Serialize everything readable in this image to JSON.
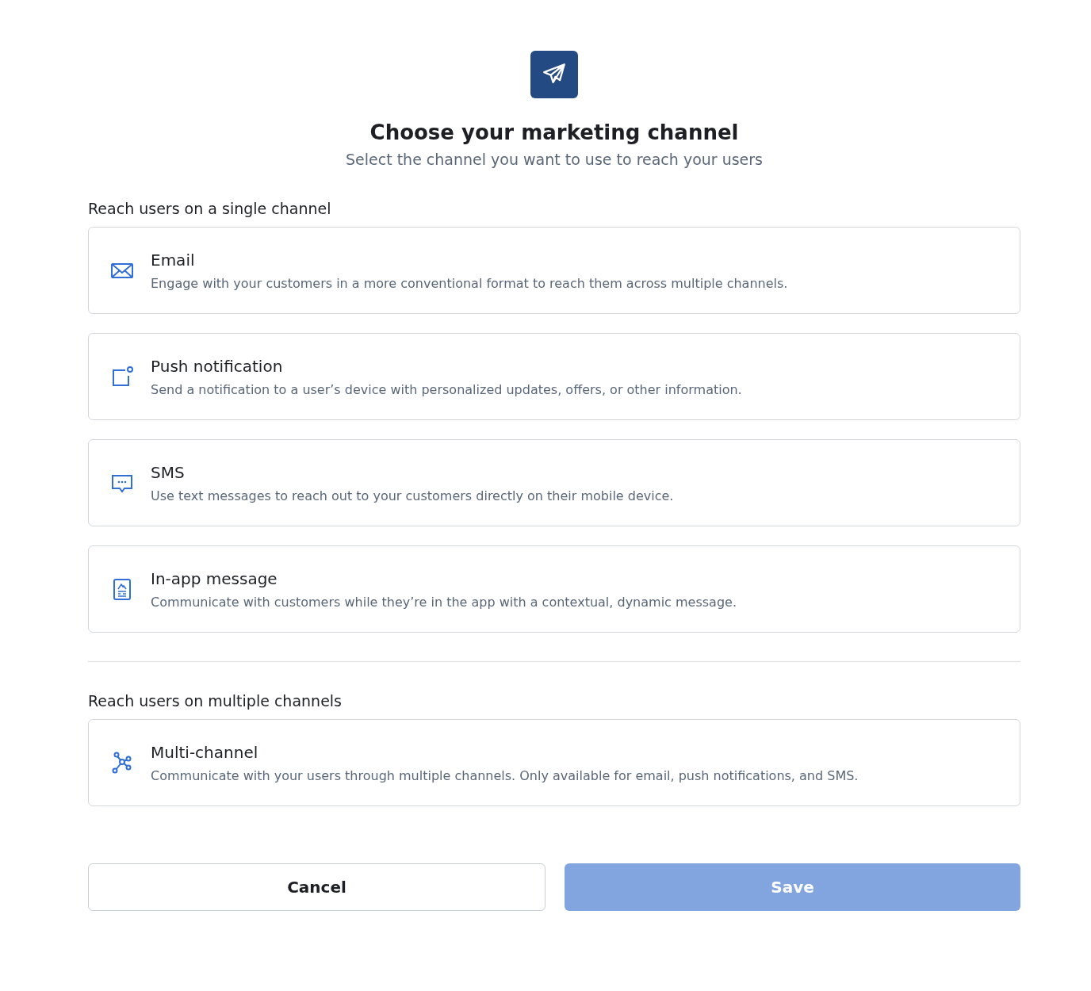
{
  "title": "Choose your marketing channel",
  "subtitle": "Select the channel you want to use to reach your users",
  "sections": [
    {
      "heading": "Reach users on a single channel",
      "channels": [
        {
          "kind": "email",
          "name": "Email",
          "description": "Engage with your customers in a more conventional format to reach them across multiple channels."
        },
        {
          "kind": "push",
          "name": "Push notification",
          "description": "Send a notification to a user’s device with personalized updates, offers, or other information."
        },
        {
          "kind": "sms",
          "name": "SMS",
          "description": "Use text messages to reach out to your customers directly on their mobile device."
        },
        {
          "kind": "inapp",
          "name": "In-app message",
          "description": "Communicate with customers while they’re in the app with a contextual, dynamic message."
        }
      ]
    },
    {
      "heading": "Reach users on multiple channels",
      "channels": [
        {
          "kind": "multi",
          "name": "Multi-channel",
          "description": "Communicate with your users through multiple channels. Only available for email, push notifications, and SMS."
        }
      ]
    }
  ],
  "buttons": [
    {
      "label": "Cancel",
      "kind": "secondary",
      "disabled": false
    },
    {
      "label": "Save",
      "kind": "primary",
      "disabled": true
    }
  ]
}
